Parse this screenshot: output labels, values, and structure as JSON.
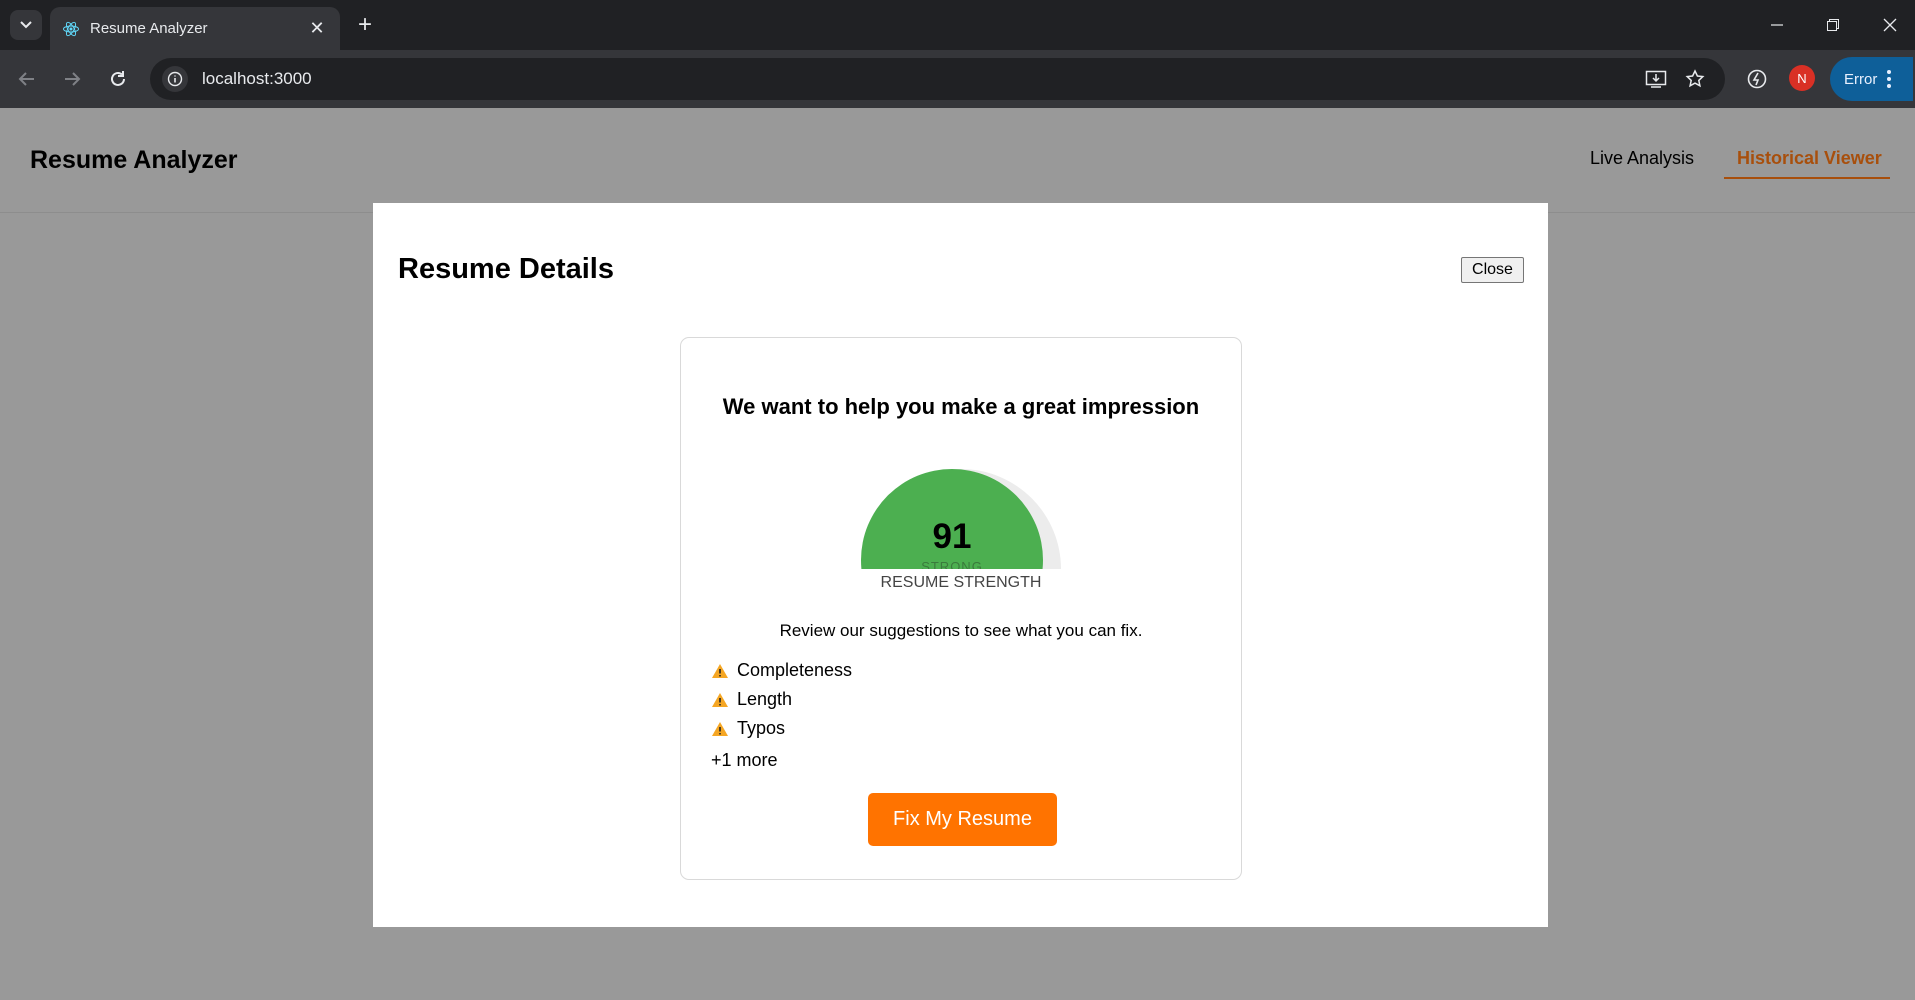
{
  "browser": {
    "tab_title": "Resume Analyzer",
    "url": "localhost:3000",
    "profile_initial": "N",
    "error_label": "Error"
  },
  "app": {
    "title": "Resume Analyzer",
    "nav": [
      {
        "label": "Live Analysis",
        "active": false
      },
      {
        "label": "Historical Viewer",
        "active": true
      }
    ]
  },
  "modal": {
    "title": "Resume Details",
    "close_label": "Close",
    "card": {
      "heading": "We want to help you make a great impression",
      "score": "91",
      "score_level": "STRONG",
      "score_fraction": 0.91,
      "gauge_label": "RESUME STRENGTH",
      "review_text": "Review our suggestions to see what you can fix.",
      "suggestions": [
        {
          "label": "Completeness",
          "icon": "warning-icon"
        },
        {
          "label": "Length",
          "icon": "warning-icon"
        },
        {
          "label": "Typos",
          "icon": "warning-icon"
        }
      ],
      "more_text": "+1 more",
      "cta_label": "Fix My Resume"
    }
  },
  "colors": {
    "accent": "#ff7300",
    "active_nav": "#a84f0c",
    "gauge_fill": "#4caf50",
    "overlay": "#999999"
  }
}
